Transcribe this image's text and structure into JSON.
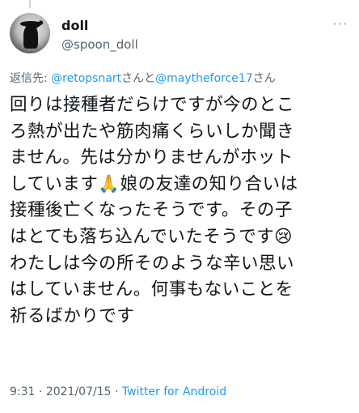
{
  "user": {
    "display_name": "doll",
    "handle": "@spoon_doll"
  },
  "more_icon": "more-horizontal-icon",
  "reply": {
    "prefix": "返信先: ",
    "mention_1": "@retopsnart",
    "connector": "さんと",
    "mention_2": "@maytheforce17",
    "suffix": "さん"
  },
  "tweet": {
    "lines": [
      "回りは接種者だらけですが今のとこ",
      "ろ熱が出たや筋肉痛くらいしか聞き",
      "ません。先は分かりませんがホット",
      "しています🙏娘の友達の知り合いは",
      "接種後亡くなったそうです。その子",
      "はとても落ち込んでいたそうです😢",
      "わたしは今の所そのような辛い思い",
      "はしていません。何事もないことを",
      "祈るばかりです"
    ]
  },
  "meta": {
    "time": "9:31",
    "separator_1": " · ",
    "date": "2021/07/15",
    "separator_2": " · ",
    "source": "Twitter for Android"
  }
}
